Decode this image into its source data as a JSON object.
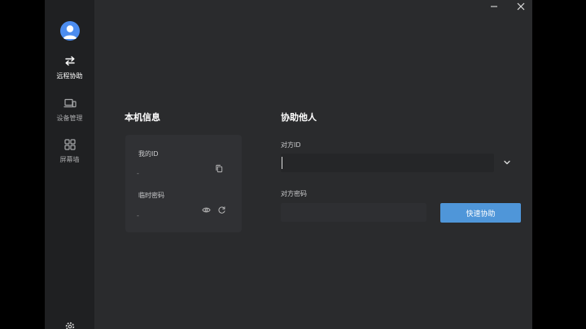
{
  "sidebar": {
    "items": [
      {
        "label": "远程协助",
        "icon": "swap-arrows-icon",
        "active": true
      },
      {
        "label": "设备管理",
        "icon": "devices-icon",
        "active": false
      },
      {
        "label": "屏幕墙",
        "icon": "grid-icon",
        "active": false
      }
    ]
  },
  "local_info": {
    "title": "本机信息",
    "my_id_label": "我的ID",
    "my_id_value": "-",
    "temp_password_label": "临时密码",
    "temp_password_value": "-"
  },
  "assist": {
    "title": "协助他人",
    "remote_id_label": "对方ID",
    "remote_id_value": "",
    "remote_password_label": "对方密码",
    "remote_password_value": "",
    "connect_button": "快速协助"
  },
  "colors": {
    "accent": "#4f96d9",
    "sidebar_bg": "#1f2022",
    "main_bg": "#2a2b2d",
    "card_bg": "#303134"
  }
}
